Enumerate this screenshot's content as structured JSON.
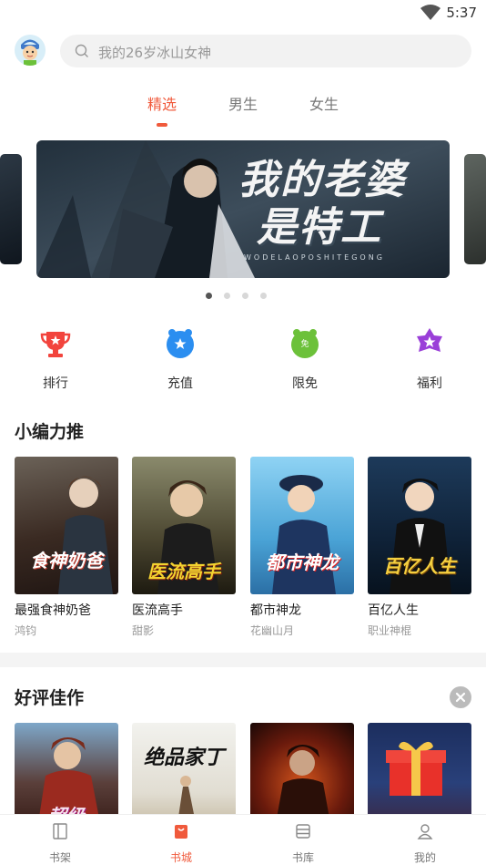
{
  "status": {
    "time": "5:37"
  },
  "search": {
    "placeholder": "我的26岁冰山女神"
  },
  "tabs": [
    {
      "label": "精选",
      "active": true
    },
    {
      "label": "男生",
      "active": false
    },
    {
      "label": "女生",
      "active": false
    }
  ],
  "banner": {
    "title_line1": "我的老婆",
    "title_line2": "是特工",
    "subtitle": "WODELAOPOSHITEGONG",
    "active_index": 0,
    "count": 4
  },
  "quick_actions": [
    {
      "label": "排行",
      "icon": "trophy-icon",
      "color": "#f2443d"
    },
    {
      "label": "充值",
      "icon": "recharge-star-icon",
      "color": "#2b8ef0"
    },
    {
      "label": "限免",
      "icon": "free-icon",
      "color": "#6cc13a",
      "badge": "免"
    },
    {
      "label": "福利",
      "icon": "gift-star-icon",
      "color": "#9a3fd8"
    }
  ],
  "section_editor": {
    "title": "小编力推",
    "books": [
      {
        "title": "最强食神奶爸",
        "author": "鸿钧",
        "cover_text": "食神奶爸"
      },
      {
        "title": "医流高手",
        "author": "甜影",
        "cover_text": "医流高手"
      },
      {
        "title": "都市神龙",
        "author": "花幽山月",
        "cover_text": "都市神龙"
      },
      {
        "title": "百亿人生",
        "author": "职业神棍",
        "cover_text": "百亿人生"
      }
    ]
  },
  "section_rated": {
    "title": "好评佳作",
    "cover_texts": [
      "超级",
      "绝品家丁"
    ]
  },
  "bottom_nav": [
    {
      "label": "书架",
      "icon": "bookshelf-icon",
      "active": false
    },
    {
      "label": "书城",
      "icon": "bookstore-icon",
      "active": true
    },
    {
      "label": "书库",
      "icon": "library-icon",
      "active": false
    },
    {
      "label": "我的",
      "icon": "profile-icon",
      "active": false
    }
  ],
  "colors": {
    "accent": "#f05a3c"
  }
}
